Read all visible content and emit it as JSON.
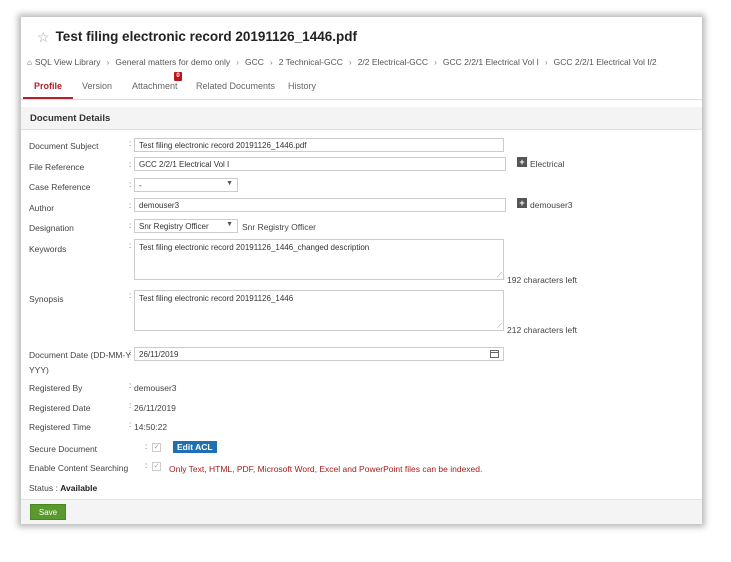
{
  "document": {
    "title": "Test filing electronic record 20191126_1446.pdf"
  },
  "breadcrumb": [
    "SQL View Library",
    "General matters for demo only",
    "GCC",
    "2 Technical-GCC",
    "2/2 Electrical-GCC",
    "GCC 2/2/1 Electrical Vol I",
    "GCC 2/2/1 Electrical Vol I/2"
  ],
  "tabs": {
    "profile": "Profile",
    "version": "Version",
    "attachment": "Attachment",
    "attachment_badge": "0",
    "related": "Related Documents",
    "history": "History"
  },
  "section": {
    "title": "Document Details"
  },
  "fields": {
    "subject_label": "Document Subject",
    "subject_value": "Test filing electronic record 20191126_1446.pdf",
    "file_ref_label": "File Reference",
    "file_ref_value": "GCC 2/2/1 Electrical Vol I",
    "file_ref_side": "Electrical",
    "case_ref_label": "Case Reference",
    "case_ref_value": "-",
    "author_label": "Author",
    "author_value": "demouser3",
    "author_side": "demouser3",
    "designation_label": "Designation",
    "designation_value": "Snr Registry Officer",
    "designation_side": "Snr Registry Officer",
    "keywords_label": "Keywords",
    "keywords_value": "Test filing electronic record 20191126_1446_changed description",
    "keywords_left": "192 characters left",
    "synopsis_label": "Synopsis",
    "synopsis_value": "Test filing electronic record 20191126_1446",
    "synopsis_left": "212 characters left",
    "docdate_label_1": "Document Date (DD-MM-Y",
    "docdate_label_2": "YYY)",
    "docdate_value": "26/11/2019",
    "registered_by_label": "Registered By",
    "registered_by_value": "demouser3",
    "registered_date_label": "Registered Date",
    "registered_date_value": "26/11/2019",
    "registered_time_label": "Registered Time",
    "registered_time_value": "14:50:22",
    "secure_label": "Secure Document",
    "edit_acl": "Edit ACL",
    "content_search_label": "Enable Content Searching",
    "content_search_note": "Only Text, HTML, PDF, Microsoft Word, Excel and PowerPoint files can be indexed.",
    "status_label": "Status :",
    "status_value": "Available"
  },
  "actions": {
    "save": "Save"
  },
  "icons": {
    "star": "star-icon",
    "home": "home-icon",
    "plus": "plus-icon",
    "calendar": "calendar-icon",
    "checkbox": "checkbox-icon"
  },
  "colors": {
    "accent": "#b5202a",
    "badge": "#c0141c",
    "edit_acl": "#1f6fb3",
    "save": "#5a9a2d",
    "note": "#a51d1d"
  }
}
